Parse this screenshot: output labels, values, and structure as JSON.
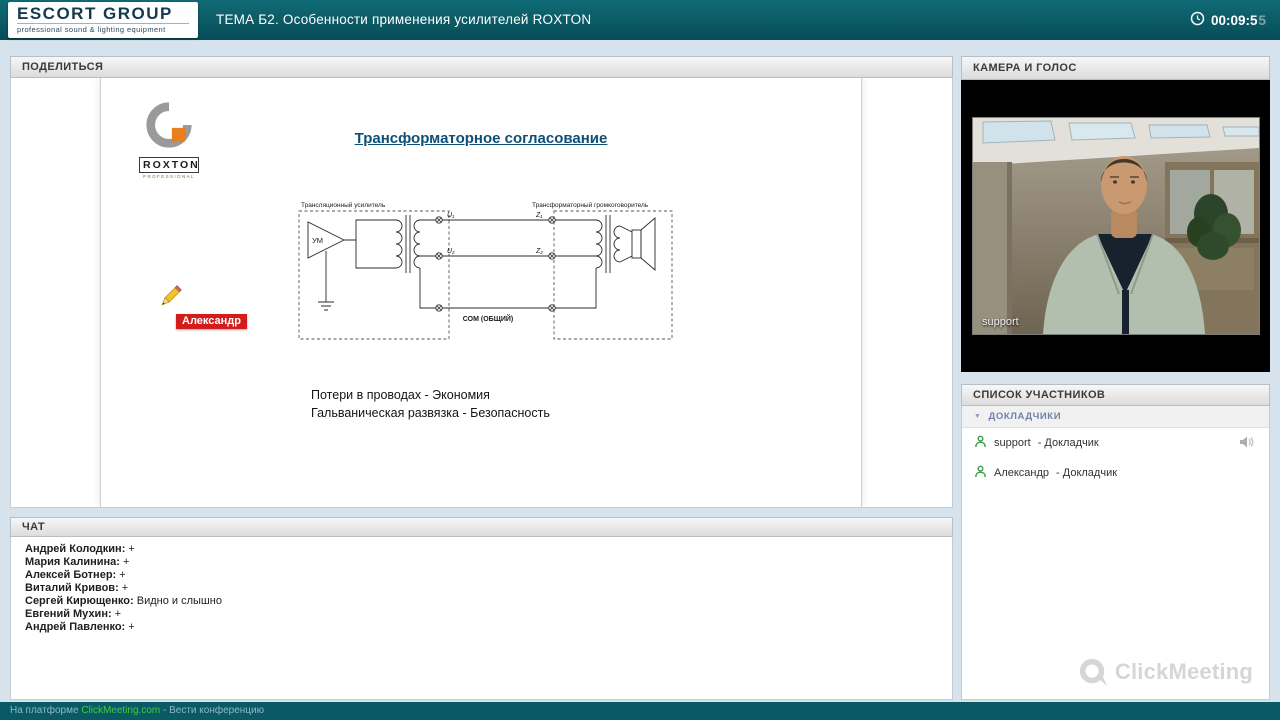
{
  "topbar": {
    "logo_title": "ESCORT GROUP",
    "logo_subtitle": "professional sound & lighting equipment",
    "title": "ТЕМА Б2. Особенности применения усилителей ROXTON",
    "timer": "00:09:5",
    "timer_fading_digit": "5"
  },
  "share": {
    "header": "ПОДЕЛИТЬСЯ",
    "slide": {
      "logo_text": "ROXTON",
      "logo_sub": "PROFESSIONAL",
      "title": "Трансформаторное согласование",
      "bullets": [
        "Потери в проводах - Экономия",
        "Гальваническая развязка - Безопасность"
      ],
      "annotation": "Александр",
      "diagram": {
        "left_box_label": "Трансляционный усилитель",
        "right_box_label": "Трансформаторный громкоговоритель",
        "amp": "УМ",
        "u1": "U₁",
        "u2": "U₂",
        "z1": "Z₁",
        "z2": "Z₂",
        "com": "СОМ (ОБЩИЙ)"
      }
    }
  },
  "camera": {
    "header": "КАМЕРА И ГОЛОС",
    "video_label": "support"
  },
  "participants": {
    "header": "СПИСОК УЧАСТНИКОВ",
    "group": "ДОКЛАДЧИКИ",
    "separator": "-",
    "items": [
      {
        "name": "support",
        "role": "Докладчик",
        "speaking": true
      },
      {
        "name": "Александр",
        "role": "Докладчик",
        "speaking": false
      }
    ],
    "watermark": "ClickMeeting"
  },
  "chat": {
    "header": "ЧАТ",
    "messages": [
      {
        "name": "Андрей Колодкин:",
        "text": "+"
      },
      {
        "name": "Мария Калинина:",
        "text": "+"
      },
      {
        "name": "Алексей Ботнер:",
        "text": "+"
      },
      {
        "name": "Виталий Кривов:",
        "text": "+"
      },
      {
        "name": "Сергей Кирющенко:",
        "text": "Видно и слышно"
      },
      {
        "name": "Евгений Мухин:",
        "text": "+"
      },
      {
        "name": "Андрей Павленко:",
        "text": "+"
      }
    ]
  },
  "footer": {
    "prefix": "На платформе",
    "link": "ClickMeeting.com",
    "suffix": "- Вести конференцию"
  }
}
